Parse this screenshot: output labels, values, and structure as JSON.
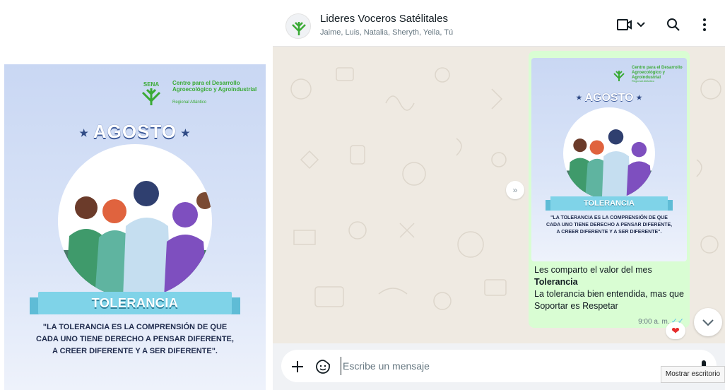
{
  "poster": {
    "org_title": "Centro para el Desarrollo Agroecológico y Agroindustrial",
    "org_sub": "Regional Atlántico",
    "logo_text": "SENA",
    "month": "AGOSTO",
    "value": "TOLERANCIA",
    "quote": "\"LA TOLERANCIA ES LA COMPRENSIÓN DE QUE CADA UNO TIENE DERECHO A PENSAR DIFERENTE, A CREER DIFERENTE Y A SER DIFERENTE\"."
  },
  "chat": {
    "group_name": "Lideres Voceros Satélitales",
    "members": "Jaime, Luis, Natalia, Sheryth, Yeila, Tú",
    "message": {
      "line1": "Les comparto el valor del mes",
      "bold": "Tolerancia",
      "line2": "La tolerancia bien entendida, mas que Soportar es Respetar",
      "time": "9:00 a. m.",
      "ticks": "✓✓",
      "reaction": "❤"
    },
    "input_placeholder": "Escribe un mensaje"
  },
  "tooltip": "Mostrar escritorio",
  "colors": {
    "chat_bg": "#efeae2",
    "bubble_out": "#d9fdd3",
    "sena_green": "#3aaa35",
    "ribbon": "#7fd3e8"
  }
}
